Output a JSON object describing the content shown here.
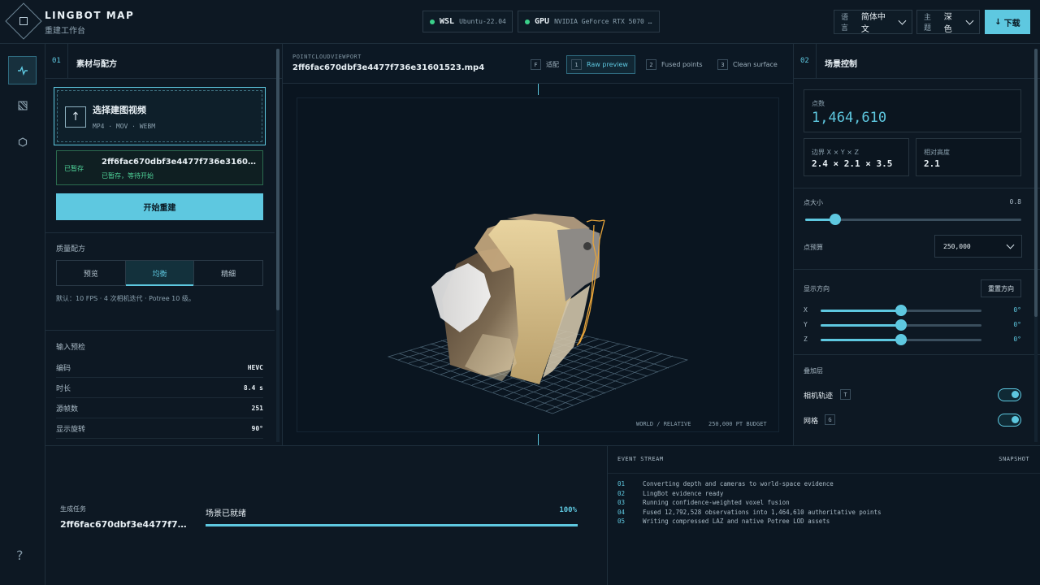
{
  "app": {
    "title": "LINGBOT MAP",
    "subtitle": "重建工作台"
  },
  "status": {
    "wsl": {
      "key": "WSL",
      "value": "Ubuntu-22.04"
    },
    "gpu": {
      "key": "GPU",
      "value": "NVIDIA GeForce RTX 5070 …"
    }
  },
  "header_controls": {
    "language_label": "语言",
    "language_value": "简体中文",
    "theme_label": "主题",
    "theme_value": "深色",
    "download_label": "下载",
    "download_icon": "download-arrow"
  },
  "rail": {
    "items": [
      "pulse-icon",
      "layers-icon",
      "hexagon-icon"
    ],
    "help": "?"
  },
  "left_panel": {
    "number": "01",
    "title": "素材与配方",
    "upload": {
      "title": "选择建图视频",
      "formats": "MP4 · MOV · WEBM",
      "icon": "upload-arrow"
    },
    "saved": {
      "badge": "已暂存",
      "name": "2ff6fac670dbf3e4477f736e3160152…",
      "status": "已暂存，等待开始"
    },
    "start_label": "开始重建",
    "quality": {
      "label": "质量配方",
      "options": [
        "预览",
        "均衡",
        "精细"
      ],
      "selected": "均衡",
      "note": "默认：10 FPS · 4 次相机迭代 · Potree 10 级。"
    },
    "precheck": {
      "label": "输入预检",
      "rows": [
        {
          "k": "编码",
          "v": "HEVC"
        },
        {
          "k": "时长",
          "v": "8.4 s"
        },
        {
          "k": "源帧数",
          "v": "251"
        },
        {
          "k": "显示旋转",
          "v": "90°"
        }
      ]
    }
  },
  "viewport": {
    "kicker": "POINTCLOUDVIEWPORT",
    "file": "2ff6fac670dbf3e4477f736e31601523.mp4",
    "buttons": [
      {
        "key": "F",
        "label": "适配"
      },
      {
        "key": "1",
        "label": "Raw preview"
      },
      {
        "key": "2",
        "label": "Fused points"
      },
      {
        "key": "3",
        "label": "Clean surface"
      }
    ],
    "active_mode": "Raw preview",
    "footer_left": "WORLD / RELATIVE",
    "footer_right": "250,000 PT BUDGET"
  },
  "right_panel": {
    "number": "02",
    "title": "场景控制",
    "points": {
      "label": "点数",
      "value": "1,464,610"
    },
    "bounds": {
      "label": "边界 X × Y × Z",
      "value": "2.4 × 2.1 × 3.5"
    },
    "height": {
      "label": "相对高度",
      "value": "2.1"
    },
    "point_size": {
      "label": "点大小",
      "value": "0.8",
      "fraction": 0.14
    },
    "budget": {
      "label": "点预算",
      "value": "250,000"
    },
    "orientation": {
      "label": "显示方向",
      "reset": "重置方向",
      "axes": [
        {
          "axis": "X",
          "value": "0°",
          "fraction": 0.5
        },
        {
          "axis": "Y",
          "value": "0°",
          "fraction": 0.5
        },
        {
          "axis": "Z",
          "value": "0°",
          "fraction": 0.5
        }
      ]
    },
    "overlays": {
      "label": "叠加层",
      "items": [
        {
          "label": "相机轨迹",
          "key": "T",
          "on": true
        },
        {
          "label": "网格",
          "key": "G",
          "on": true
        }
      ]
    }
  },
  "job": {
    "label": "生成任务",
    "name": "2ff6fac670dbf3e4477f736…",
    "progress_label": "场景已就绪",
    "progress_text": "100%",
    "progress": 1.0
  },
  "event_stream": {
    "title": "EVENT STREAM",
    "snapshot": "SNAPSHOT",
    "lines": [
      {
        "n": "01",
        "text": "Converting depth and cameras to world-space evidence"
      },
      {
        "n": "02",
        "text": "LingBot evidence ready"
      },
      {
        "n": "03",
        "text": "Running confidence-weighted voxel fusion"
      },
      {
        "n": "04",
        "text": "Fused 12,792,528 observations into 1,464,610 authoritative points"
      },
      {
        "n": "05",
        "text": "Writing compressed LAZ and native Potree LOD assets"
      }
    ]
  },
  "colors": {
    "accent": "#5ec8e0",
    "ok": "#3bd08a",
    "background": "#0b1520"
  }
}
